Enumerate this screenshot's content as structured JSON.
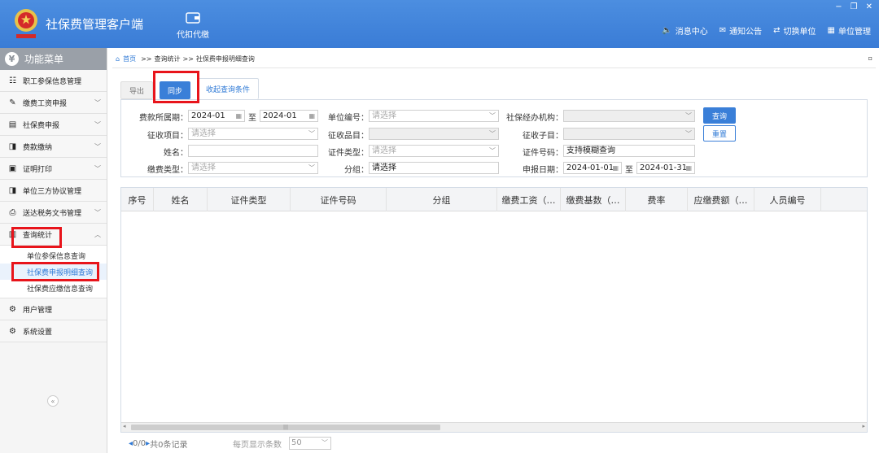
{
  "app": {
    "title": "社保费管理客户端",
    "logo": "national-emblem-icon"
  },
  "toolbar": {
    "daikou": "代扣代缴"
  },
  "topnav": [
    {
      "label": "消息中心",
      "icon": "speaker-icon"
    },
    {
      "label": "通知公告",
      "icon": "mail-icon"
    },
    {
      "label": "切换单位",
      "icon": "switch-icon"
    },
    {
      "label": "单位管理",
      "icon": "building-icon"
    }
  ],
  "window": {
    "min": "−",
    "max": "❐",
    "close": "✕"
  },
  "sidebar": {
    "header": "功能菜单",
    "items": [
      {
        "label": "职工参保信息管理",
        "icon": "list-icon"
      },
      {
        "label": "缴费工资申报",
        "icon": "edit-icon"
      },
      {
        "label": "社保费申报",
        "icon": "form-icon"
      },
      {
        "label": "费款缴纳",
        "icon": "bookmark-icon"
      },
      {
        "label": "证明打印",
        "icon": "document-icon"
      },
      {
        "label": "单位三方协议管理",
        "icon": "bookmark-icon"
      },
      {
        "label": "送达税务文书管理",
        "icon": "print-icon"
      },
      {
        "label": "查询统计",
        "icon": "report-icon"
      },
      {
        "label": "用户管理",
        "icon": "gear-icon"
      },
      {
        "label": "系统设置",
        "icon": "gear-icon"
      }
    ],
    "sub": [
      "单位参保信息查询",
      "社保费申报明细查询",
      "社保费应缴信息查询"
    ],
    "collapse": "«"
  },
  "breadcrumb": {
    "home": "首页",
    "sep": ">>",
    "level1": "查询统计",
    "level2": "社保费申报明细查询",
    "close": "▫"
  },
  "actions": {
    "export": "导出",
    "sync": "同步",
    "collapse": "收起查询条件"
  },
  "form": {
    "period_label": "费款所属期：",
    "period_from": "2024-01",
    "period_to": "2024-01",
    "to": "至",
    "unit_no_label": "单位编号：",
    "unit_no_ph": "请选择",
    "agency_label": "社保经办机构：",
    "item_label": "征收项目：",
    "item_ph": "请选择",
    "category_label": "征收品目：",
    "subitem_label": "征收子目：",
    "name_label": "姓名：",
    "idtype_label": "证件类型：",
    "idtype_ph": "请选择",
    "idno_label": "证件号码：",
    "idno_value": "支持模糊查询",
    "paytype_label": "缴费类型：",
    "paytype_ph": "请选择",
    "group_label": "分组：",
    "group_value": "请选择",
    "date_label": "申报日期：",
    "date_from": "2024-01-01",
    "date_to": "2024-01-31",
    "query": "查询",
    "reset": "重置"
  },
  "table": {
    "columns": [
      "序号",
      "姓名",
      "证件类型",
      "证件号码",
      "分组",
      "缴费工资（…",
      "缴费基数（…",
      "费率",
      "应缴费额（…",
      "人员编号"
    ]
  },
  "pager": {
    "prev": "◂",
    "page": "0/0",
    "next": "▸",
    "total": "共0条记录",
    "size_label": "每页显示条数",
    "size": "50"
  }
}
